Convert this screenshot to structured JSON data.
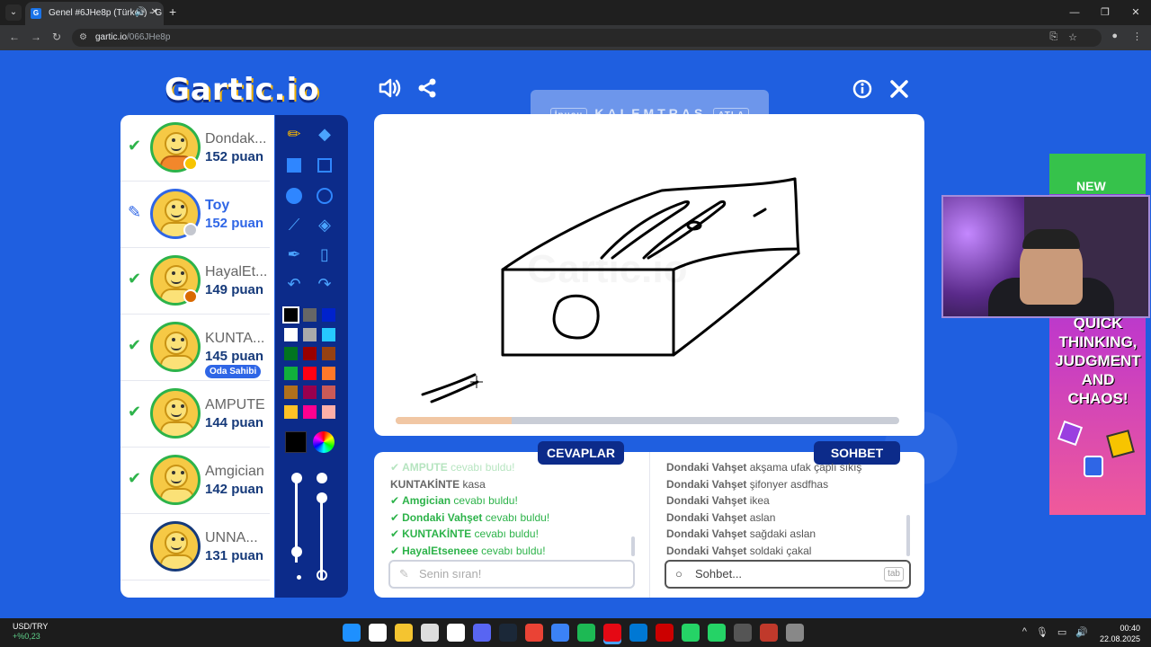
{
  "browser": {
    "tab_title": "Genel #6JHe8p (Türkçe) - G",
    "url_host": "gartic.io",
    "url_path": "/066JHe8p"
  },
  "game": {
    "logo": "Gartic.io",
    "word_hint": "KALEMTRAŞ",
    "hint_left": "İpucu",
    "hint_right": "ATLA",
    "watermark": "Gartic.io",
    "progress": 0.23
  },
  "players": [
    {
      "name": "Dondak...",
      "score": "152 puan",
      "status": "guessed",
      "shirt": "orange",
      "dot": "#f7c400",
      "ring": "green"
    },
    {
      "name": "Toy",
      "score": "152 puan",
      "status": "drawing",
      "shirt": "yellow",
      "dot": "#c4c7cf",
      "ring": "blue",
      "me": true
    },
    {
      "name": "HayalEt...",
      "score": "149 puan",
      "status": "guessed",
      "shirt": "yellow",
      "dot": "#d96a00",
      "ring": "green"
    },
    {
      "name": "KUNTA...",
      "score": "145 puan",
      "status": "guessed",
      "shirt": "yellow",
      "ring": "green",
      "owner": "Oda Sahibi"
    },
    {
      "name": "AMPUTE",
      "score": "144 puan",
      "status": "guessed",
      "shirt": "yellow",
      "ring": "green"
    },
    {
      "name": "Amgician",
      "score": "142 puan",
      "status": "guessed",
      "shirt": "yellow",
      "ring": "green"
    },
    {
      "name": "UNNA...",
      "score": "131 puan",
      "status": "none",
      "shirt": "yellow",
      "ring": "navy"
    }
  ],
  "palette": [
    "#000000",
    "#666666",
    "#0022cc",
    "#ffffff",
    "#aaaaaa",
    "#26c9ff",
    "#017420",
    "#990000",
    "#964112",
    "#11b03c",
    "#ff0013",
    "#ff7829",
    "#b0701c",
    "#99004e",
    "#cb5a57",
    "#ffc126",
    "#ff008f",
    "#feafa8"
  ],
  "answers": {
    "title": "CEVAPLAR",
    "messages": [
      {
        "who": "AMPUTE",
        "text": "cevabı buldu!",
        "type": "correct",
        "faded": true
      },
      {
        "who": "KUNTAKİNTE",
        "text": "kasa",
        "type": "plain"
      },
      {
        "who": "Amgician",
        "text": "cevabı buldu!",
        "type": "correct"
      },
      {
        "who": "Dondaki Vahşet",
        "text": "cevabı buldu!",
        "type": "correct"
      },
      {
        "who": "KUNTAKİNTE",
        "text": "cevabı buldu!",
        "type": "correct"
      },
      {
        "who": "HayalEtseneee",
        "text": "cevabı buldu!",
        "type": "correct"
      }
    ],
    "placeholder": "Senin sıran!"
  },
  "chat": {
    "title": "SOHBET",
    "messages": [
      {
        "who": "Dondaki Vahşet",
        "text": "akşama ufak çaplı sıkış"
      },
      {
        "who": "Dondaki Vahşet",
        "text": "şifonyer asdfhas"
      },
      {
        "who": "Dondaki Vahşet",
        "text": "ikea"
      },
      {
        "who": "Dondaki Vahşet",
        "text": "aslan"
      },
      {
        "who": "Dondaki Vahşet",
        "text": "sağdaki aslan"
      },
      {
        "who": "Dondaki Vahşet",
        "text": "soldaki çakal"
      }
    ],
    "placeholder": "Sohbet...",
    "tab_hint": "tab"
  },
  "ad": {
    "top": "NEW",
    "text": "QUICK THINKING, JUDGMENT AND CHAOS!"
  },
  "taskbar": {
    "ticker": "USD/TRY",
    "change": "+%0,23",
    "time": "00:40",
    "date": "22.08.2025",
    "apps": [
      "#1e90ff",
      "#ffffff",
      "#f4c430",
      "#dddddd",
      "#ffffff",
      "#5865f2",
      "#1b2838",
      "#ea4335",
      "#3b82f6",
      "#1db954",
      "#e50914",
      "#0078d4",
      "#cc0000",
      "#25d366",
      "#25d366",
      "#555555",
      "#c0392b",
      "#888888"
    ]
  }
}
